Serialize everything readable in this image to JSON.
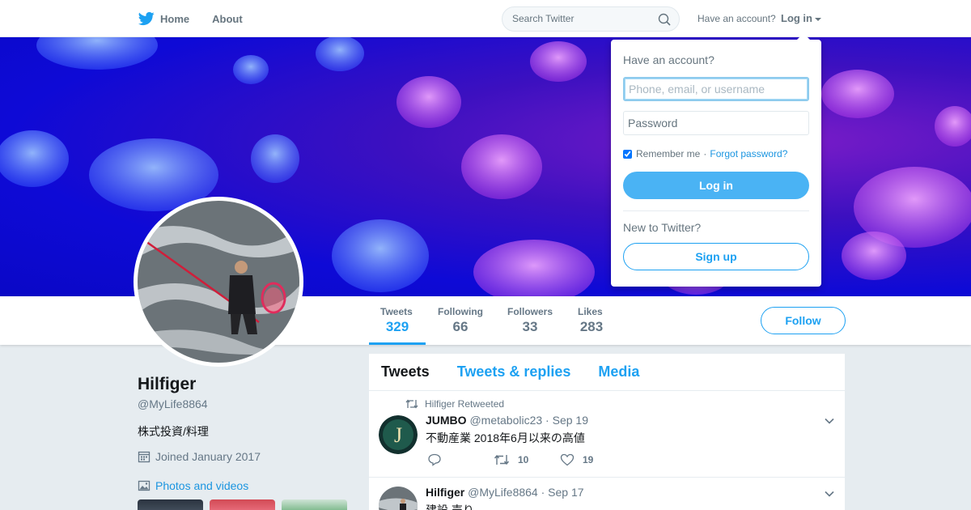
{
  "nav": {
    "home_label": "Home",
    "about_label": "About",
    "search_placeholder": "Search Twitter",
    "have_account": "Have an account?",
    "login_label": "Log in"
  },
  "profile": {
    "name": "Hilfiger",
    "handle": "@MyLife8864",
    "bio": "株式投資/料理",
    "joined": "Joined January 2017",
    "photos_label": "Photos and videos",
    "follow_label": "Follow"
  },
  "stats": [
    {
      "label": "Tweets",
      "value": "329"
    },
    {
      "label": "Following",
      "value": "66"
    },
    {
      "label": "Followers",
      "value": "33"
    },
    {
      "label": "Likes",
      "value": "283"
    }
  ],
  "timeline": {
    "tabs": [
      "Tweets",
      "Tweets & replies",
      "Media"
    ],
    "tweets": [
      {
        "context": "Hilfiger Retweeted",
        "fullname": "JUMBO",
        "username": "@metabolic23",
        "time": "Sep 19",
        "text": "不動産業  2018年6月以来の高値",
        "retweets": "10",
        "likes": "19"
      },
      {
        "fullname": "Hilfiger",
        "username": "@MyLife8864",
        "time": "Sep 17",
        "text": "建設 売り"
      }
    ]
  },
  "login_dropdown": {
    "title": "Have an account?",
    "username_placeholder": "Phone, email, or username",
    "password_placeholder": "Password",
    "remember_label": "Remember me",
    "separator": "·",
    "forgot_label": "Forgot password?",
    "login_button": "Log in",
    "new_label": "New to Twitter?",
    "signup_button": "Sign up"
  },
  "colors": {
    "accent": "#1da1f2",
    "login_button": "#4ab3f4",
    "banner": "#0e0ad6"
  },
  "icons": [
    "twitter-bird-icon",
    "search-icon",
    "calendar-icon",
    "photo-icon",
    "retweet-icon",
    "reply-icon",
    "like-icon",
    "chevron-down-icon"
  ]
}
